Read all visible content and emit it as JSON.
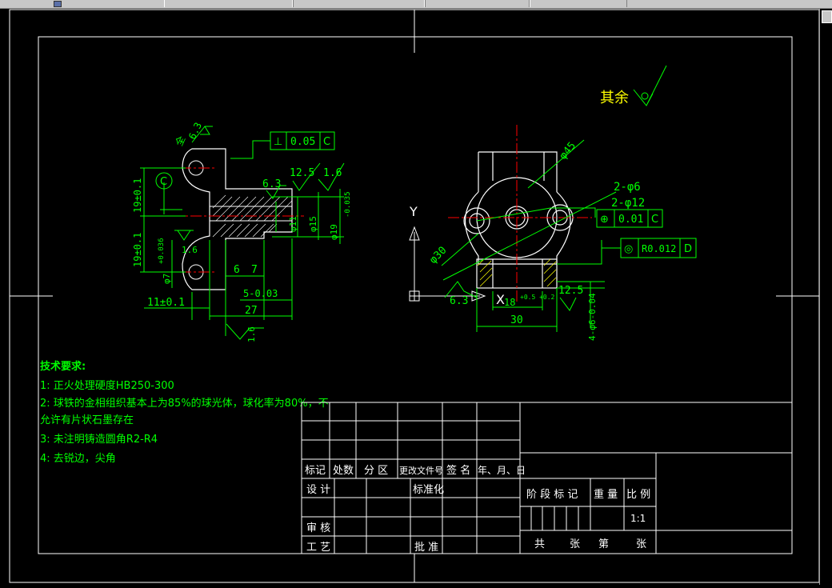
{
  "colors": {
    "background": "#000000",
    "outline": "#ffffff",
    "dimension": "#00ff00",
    "centerline": "#ff0000",
    "accent_yellow": "#ffff00"
  },
  "surface_finish_note": {
    "label": "其余"
  },
  "left_view": {
    "roughness_top": "6.3",
    "roughness_top_prefix": "全",
    "datum_c": "C",
    "tolerance_box": {
      "symbol": "⊥",
      "value": "0.05",
      "datum": "C"
    },
    "roughness_labels": [
      "6.3",
      "12.5",
      "1.6"
    ],
    "dims_vertical": [
      "19±0.1",
      "19±0.1"
    ],
    "dims_diameters": [
      "φ11",
      "φ15",
      "φ19",
      "φ7",
      "-0.035",
      "+0.036"
    ],
    "small_roughness": "1.6",
    "dims_horizontal": [
      "6",
      "7",
      "5-0.03",
      "27",
      "11±0.1"
    ],
    "roughness_bottom": "1.6"
  },
  "right_view": {
    "axis_y": "Y",
    "axis_x": "X",
    "dia_45": "φ45",
    "dia_30": "φ30",
    "hole_6": "2-φ6",
    "hole_12": "2-φ12",
    "pos_tolerance": {
      "symbol": "⊕",
      "value": "0.01",
      "datum": "C"
    },
    "conc_tolerance": {
      "symbol": "◎",
      "value": "R0.012",
      "datum": "D"
    },
    "roughness_left": "6.3",
    "roughness_right": "12.5",
    "dim_18": "18",
    "dim_18_tol": "+0.5 +0.2",
    "dim_30": "30",
    "hole_dia_side": "4-φ6-0.04"
  },
  "tech_requirements": {
    "title": "技术要求:",
    "items": [
      "1: 正火处理硬度HB250-300",
      "2: 球铁的金相组织基本上为85%的球光体，球化率为80%，不",
      "允许有片状石墨存在",
      "3: 未注明铸造圆角R2-R4",
      "4: 去锐边，尖角"
    ]
  },
  "title_block": {
    "header_row": [
      "标记",
      "处数",
      "分 区",
      "更改文件号",
      "签 名",
      "年、月、日"
    ],
    "design": "设 计",
    "standardization": "标准化",
    "review": "审 核",
    "process": "工 艺",
    "approve": "批 准",
    "stage_mark": "阶 段 标 记",
    "weight": "重 量",
    "scale": "比 例",
    "scale_value": "1:1",
    "sheets_total": "共",
    "sheets_unit1": "张",
    "sheet_no": "第",
    "sheets_unit2": "张"
  }
}
